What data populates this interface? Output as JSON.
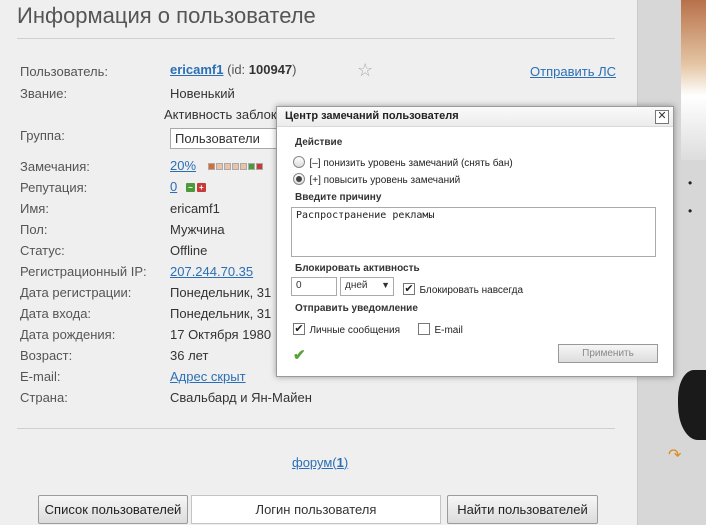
{
  "title": "Информация о пользователе",
  "send_pm": "Отправить ЛС",
  "activity_blocked_note": "Активность заблок",
  "profile": {
    "user": {
      "label": "Пользователь:",
      "name": "ericamf1",
      "id_prefix": "(id: ",
      "id": "100947",
      "id_suffix": ")"
    },
    "rank": {
      "label": "Звание:",
      "value": "Новенький"
    },
    "group": {
      "label": "Группа:",
      "value": "Пользователи"
    },
    "warnings": {
      "label": "Замечания:",
      "value": "20%"
    },
    "reputation": {
      "label": "Репутация:",
      "value": "0"
    },
    "name": {
      "label": "Имя:",
      "value": "ericamf1"
    },
    "gender": {
      "label": "Пол:",
      "value": "Мужчина"
    },
    "status": {
      "label": "Статус:",
      "value": "Offline"
    },
    "reg_ip": {
      "label": "Регистрационный IP:",
      "value": "207.244.70.35"
    },
    "reg_date": {
      "label": "Дата регистрации:",
      "value": "Понедельник, 31"
    },
    "login_date": {
      "label": "Дата входа:",
      "value": "Понедельник, 31"
    },
    "birth_date": {
      "label": "Дата рождения:",
      "value": "17 Октября 1980"
    },
    "age": {
      "label": "Возраст:",
      "value": "36 лет"
    },
    "email": {
      "label": "E-mail:",
      "value": "Адрес скрыт"
    },
    "country": {
      "label": "Страна:",
      "value": "Свальбард и Ян-Майен"
    }
  },
  "warn_levels": 5,
  "forum": {
    "prefix": "форум(",
    "count": "1",
    "suffix": ")"
  },
  "bottom": {
    "users_list": "Список пользователей",
    "login_placeholder": "Логин пользователя",
    "find_users": "Найти пользователей"
  },
  "modal": {
    "title": "Центр замечаний пользователя",
    "action_label": "Действие",
    "lower": "[–] понизить уровень замечаний (снять бан)",
    "raise": "[+] повысить уровень замечаний",
    "reason_label": "Введите причину",
    "reason_value": "Распространение рекламы",
    "block_label": "Блокировать активность",
    "block_amount": "0",
    "block_unit": "дней",
    "block_forever": "Блокировать навсегда",
    "notify_label": "Отправить уведомление",
    "notify_pm": "Личные сообщения",
    "notify_email": "E-mail",
    "apply": "Применить"
  },
  "colors": {
    "link": "#2a6fb6",
    "warn_green": "#4a9a3a",
    "warn_red": "#c83a3a",
    "check": "#5aa23a"
  }
}
